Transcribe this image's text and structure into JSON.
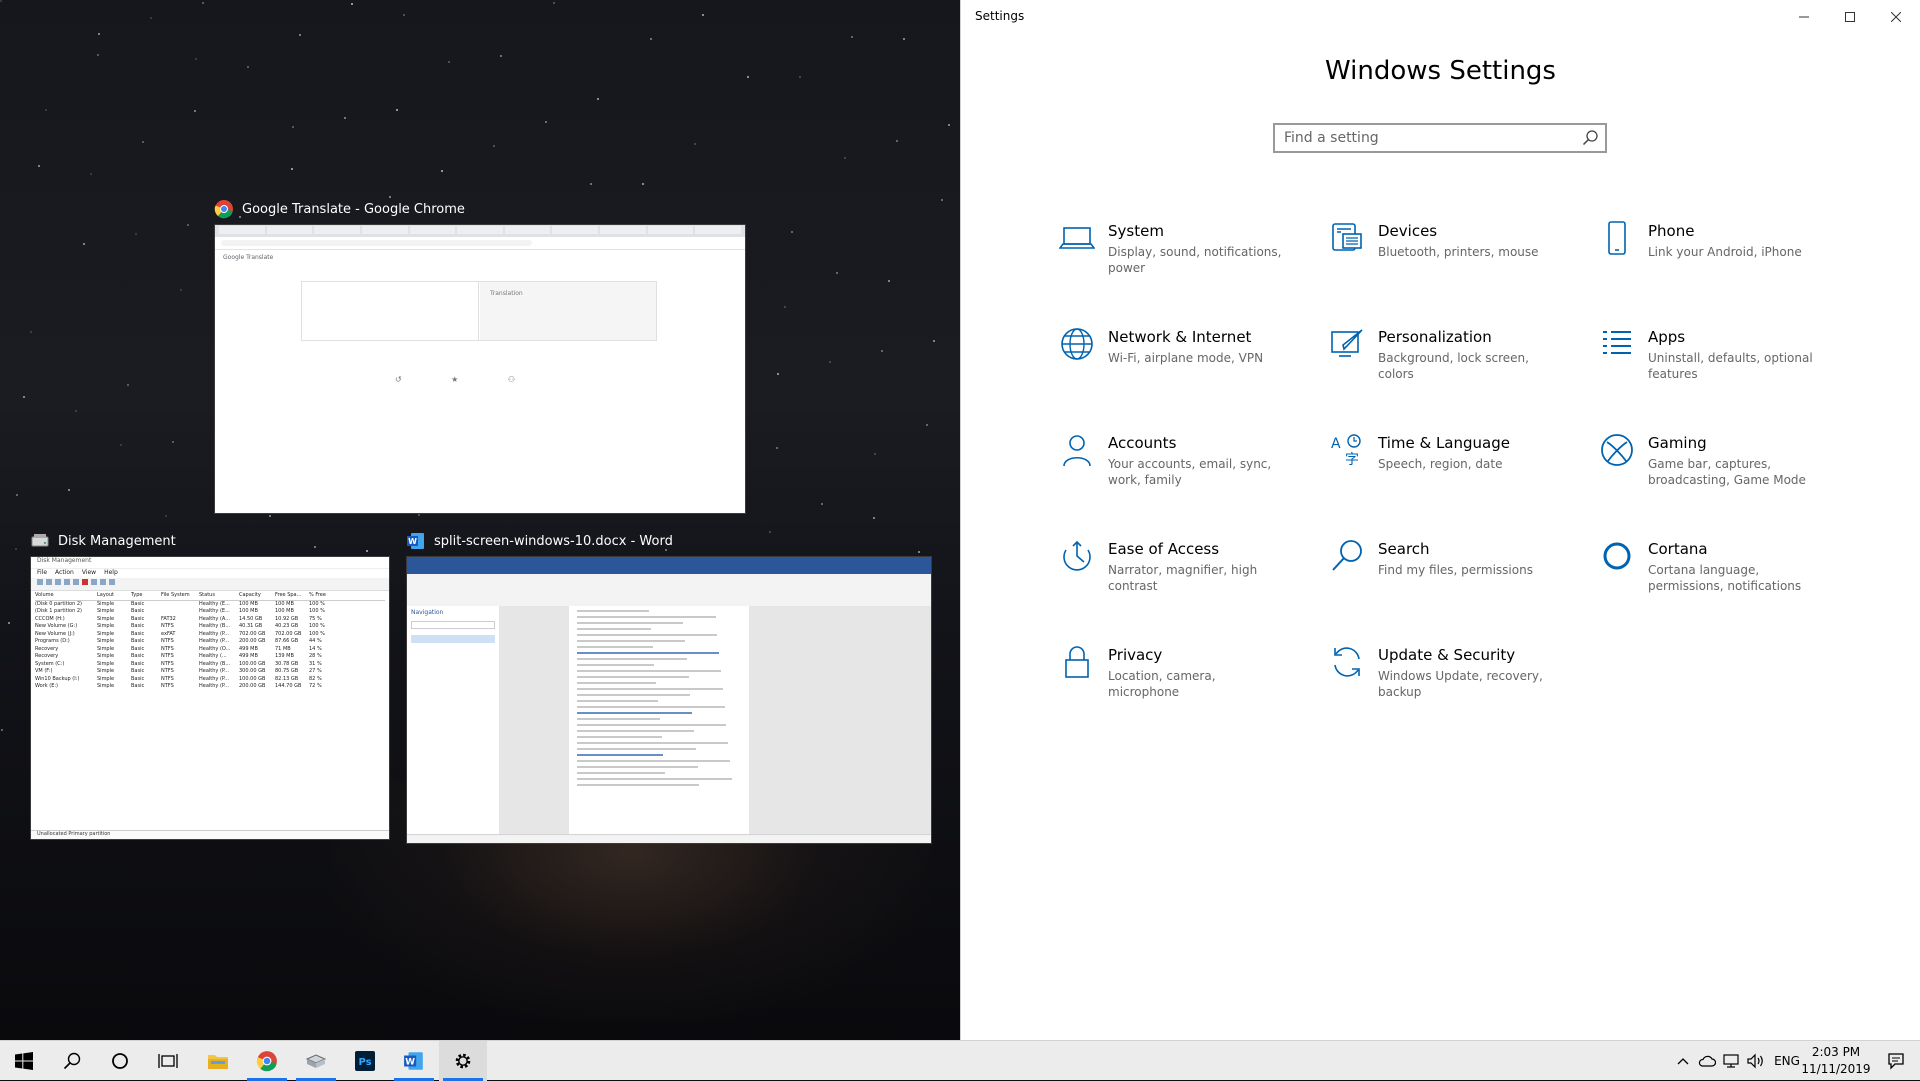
{
  "snap": {
    "chrome": {
      "title": "Google Translate - Google Chrome",
      "app_name": "Google Translate",
      "translation_label": "Translation"
    },
    "disk": {
      "title": "Disk Management",
      "window_title": "Disk Management",
      "menu": [
        "File",
        "Action",
        "View",
        "Help"
      ],
      "columns": [
        "Volume",
        "Layout",
        "Type",
        "File System",
        "Status",
        "Capacity",
        "Free Spa...",
        "% Free"
      ],
      "rows": [
        [
          "(Disk 0 partition 2)",
          "Simple",
          "Basic",
          "",
          "Healthy (E...",
          "100 MB",
          "100 MB",
          "100 %"
        ],
        [
          "(Disk 1 partition 2)",
          "Simple",
          "Basic",
          "",
          "Healthy (E...",
          "100 MB",
          "100 MB",
          "100 %"
        ],
        [
          "CCCOM (H:)",
          "Simple",
          "Basic",
          "FAT32",
          "Healthy (A...",
          "14.50 GB",
          "10.92 GB",
          "75 %"
        ],
        [
          "New Volume (G:)",
          "Simple",
          "Basic",
          "NTFS",
          "Healthy (B...",
          "40.31 GB",
          "40.23 GB",
          "100 %"
        ],
        [
          "New Volume (J:)",
          "Simple",
          "Basic",
          "exFAT",
          "Healthy (P...",
          "702.00 GB",
          "702.00 GB",
          "100 %"
        ],
        [
          "Programs (D:)",
          "Simple",
          "Basic",
          "NTFS",
          "Healthy (P...",
          "200.00 GB",
          "87.66 GB",
          "44 %"
        ],
        [
          "Recovery",
          "Simple",
          "Basic",
          "NTFS",
          "Healthy (O...",
          "499 MB",
          "71 MB",
          "14 %"
        ],
        [
          "Recovery",
          "Simple",
          "Basic",
          "NTFS",
          "Healthy (...",
          "499 MB",
          "139 MB",
          "28 %"
        ],
        [
          "System (C:)",
          "Simple",
          "Basic",
          "NTFS",
          "Healthy (B...",
          "100.00 GB",
          "30.78 GB",
          "31 %"
        ],
        [
          "VM (F:)",
          "Simple",
          "Basic",
          "NTFS",
          "Healthy (P...",
          "300.00 GB",
          "80.75 GB",
          "27 %"
        ],
        [
          "Win10 Backup (I:)",
          "Simple",
          "Basic",
          "NTFS",
          "Healthy (P...",
          "100.00 GB",
          "82.13 GB",
          "82 %"
        ],
        [
          "Work (E:)",
          "Simple",
          "Basic",
          "NTFS",
          "Healthy (P...",
          "200.00 GB",
          "144.70 GB",
          "72 %"
        ]
      ],
      "legend": "Unallocated  Primary partition"
    },
    "word": {
      "title": "split-screen-windows-10.docx - Word",
      "nav_label": "Navigation"
    }
  },
  "settings": {
    "window_title": "Settings",
    "page_title": "Windows Settings",
    "search_placeholder": "Find a setting",
    "accent": "#0063b1",
    "tiles": [
      {
        "icon": "laptop-icon",
        "name": "System",
        "desc": "Display, sound, notifications, power"
      },
      {
        "icon": "keyboard-icon",
        "name": "Devices",
        "desc": "Bluetooth, printers, mouse"
      },
      {
        "icon": "phone-icon",
        "name": "Phone",
        "desc": "Link your Android, iPhone"
      },
      {
        "icon": "globe-icon",
        "name": "Network & Internet",
        "desc": "Wi-Fi, airplane mode, VPN"
      },
      {
        "icon": "paintbrush-icon",
        "name": "Personalization",
        "desc": "Background, lock screen, colors"
      },
      {
        "icon": "apps-list-icon",
        "name": "Apps",
        "desc": "Uninstall, defaults, optional features"
      },
      {
        "icon": "person-icon",
        "name": "Accounts",
        "desc": "Your accounts, email, sync, work, family"
      },
      {
        "icon": "language-icon",
        "name": "Time & Language",
        "desc": "Speech, region, date"
      },
      {
        "icon": "xbox-icon",
        "name": "Gaming",
        "desc": "Game bar, captures, broadcasting, Game Mode"
      },
      {
        "icon": "ease-of-access-icon",
        "name": "Ease of Access",
        "desc": "Narrator, magnifier, high contrast"
      },
      {
        "icon": "search-icon",
        "name": "Search",
        "desc": "Find my files, permissions"
      },
      {
        "icon": "cortana-icon",
        "name": "Cortana",
        "desc": "Cortana language, permissions, notifications"
      },
      {
        "icon": "lock-icon",
        "name": "Privacy",
        "desc": "Location, camera, microphone"
      },
      {
        "icon": "update-icon",
        "name": "Update & Security",
        "desc": "Windows Update, recovery, backup"
      }
    ]
  },
  "taskbar": {
    "language": "ENG",
    "time": "2:03 PM",
    "date": "11/11/2019"
  }
}
